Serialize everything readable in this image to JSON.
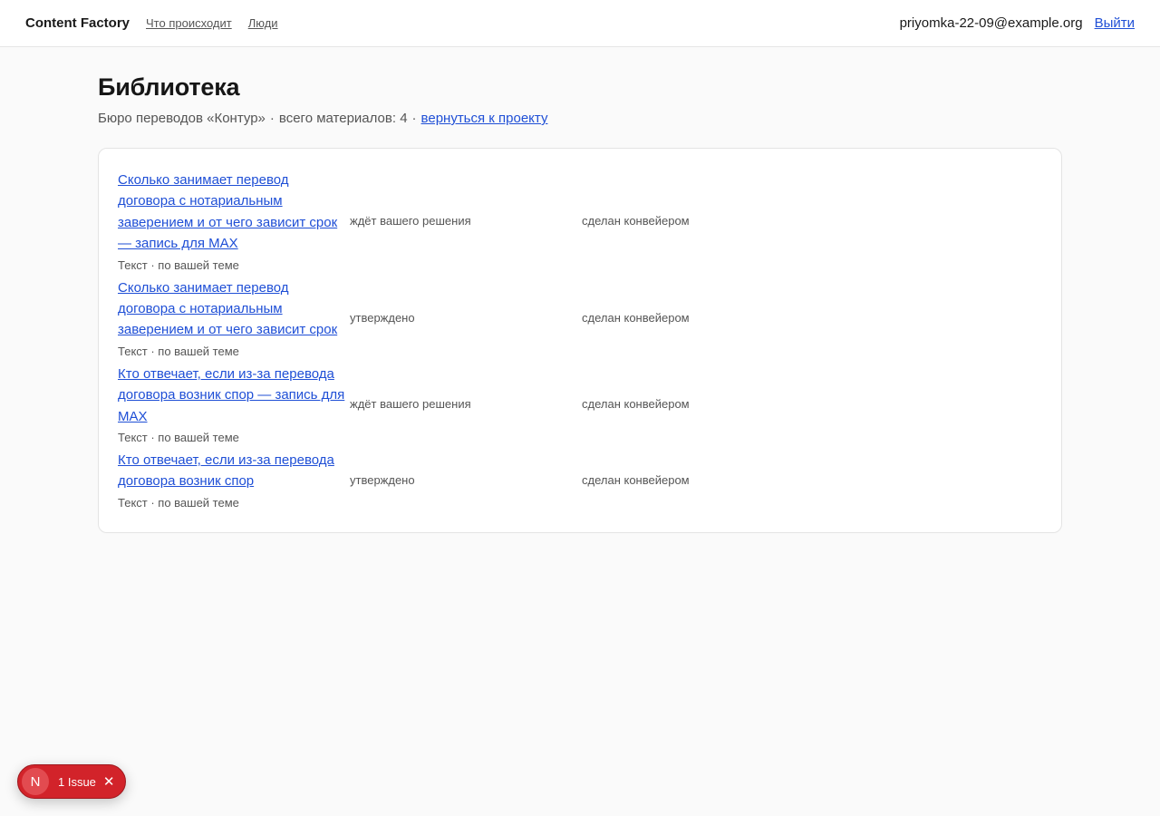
{
  "header": {
    "brand": "Content Factory",
    "nav": [
      "Что происходит",
      "Люди"
    ],
    "user_email": "priyomka-22-09@example.org",
    "logout_label": "Выйти"
  },
  "page": {
    "title": "Библиотека",
    "subtitle_project": "Бюро переводов «Контур»",
    "subtitle_separator": "·",
    "subtitle_count": "всего материалов: 4",
    "back_link": "вернуться к проекту"
  },
  "items": [
    {
      "title": "Сколько занимает перевод договора с нотариальным заверением и от чего зависит срок — запись для MAX",
      "meta": "Текст · по вашей теме",
      "status": "ждёт вашего решения",
      "source": "сделан конвейером"
    },
    {
      "title": "Сколько занимает перевод договора с нотариальным заверением и от чего зависит срок",
      "meta": "Текст · по вашей теме",
      "status": "утверждено",
      "source": "сделан конвейером"
    },
    {
      "title": "Кто отвечает, если из-за перевода договора возник спор — запись для MAX",
      "meta": "Текст · по вашей теме",
      "status": "ждёт вашего решения",
      "source": "сделан конвейером"
    },
    {
      "title": "Кто отвечает, если из-за перевода договора возник спор",
      "meta": "Текст · по вашей теме",
      "status": "утверждено",
      "source": "сделан конвейером"
    }
  ],
  "issue_badge": {
    "icon_letter": "N",
    "label": "1 Issue",
    "close_icon": "close-icon"
  },
  "colors": {
    "link": "#1f4fd6",
    "badge": "#d2232a"
  }
}
